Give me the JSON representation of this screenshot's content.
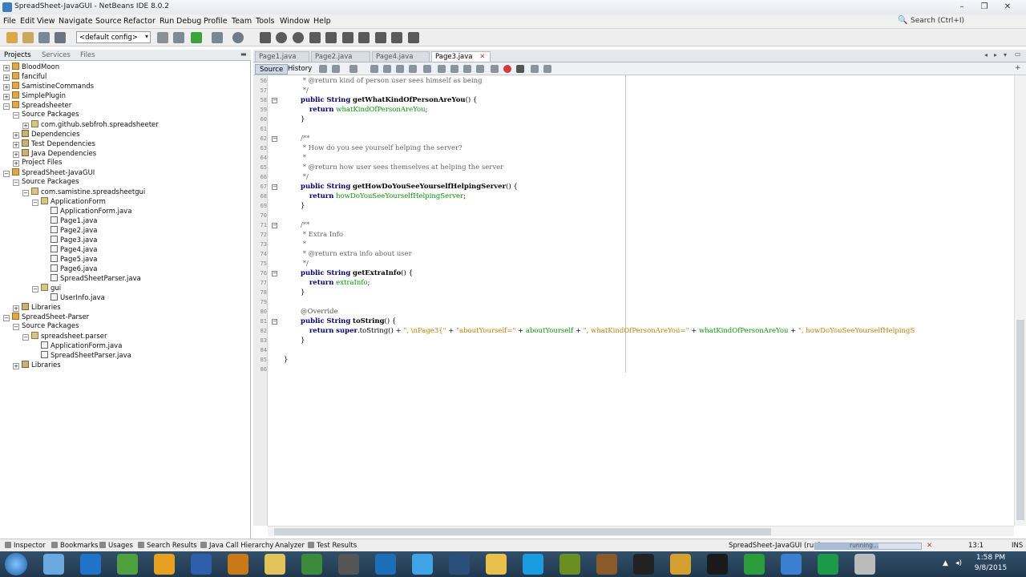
{
  "window": {
    "title": "SpreadSheet-JavaGUI - NetBeans IDE 8.0.2",
    "controls": [
      "–",
      "❐",
      "✕"
    ]
  },
  "menubar": {
    "items": [
      "File",
      "Edit",
      "View",
      "Navigate",
      "Source",
      "Refactor",
      "Run",
      "Debug",
      "Profile",
      "Team",
      "Tools",
      "Window",
      "Help"
    ],
    "search_placeholder": "Search (Ctrl+I)"
  },
  "toolbar": {
    "config_value": "<default config>"
  },
  "left_panel": {
    "tabs": [
      "Projects",
      "Services",
      "Files"
    ],
    "tree": [
      {
        "label": "BloodMoon",
        "depth": 0,
        "icon": "proj",
        "exp": "+"
      },
      {
        "label": "fanciful",
        "depth": 0,
        "icon": "proj",
        "exp": "+"
      },
      {
        "label": "SamistineCommands",
        "depth": 0,
        "icon": "proj",
        "exp": "+"
      },
      {
        "label": "SimplePlugin",
        "depth": 0,
        "icon": "proj",
        "exp": "+"
      },
      {
        "label": "Spreadsheeter",
        "depth": 0,
        "icon": "proj",
        "exp": "−"
      },
      {
        "label": "Source Packages",
        "depth": 1,
        "icon": "fold",
        "exp": "−"
      },
      {
        "label": "com.github.sebfroh.spreadsheeter",
        "depth": 2,
        "icon": "pkg",
        "exp": "+"
      },
      {
        "label": "Dependencies",
        "depth": 1,
        "icon": "lib",
        "exp": "+"
      },
      {
        "label": "Test Dependencies",
        "depth": 1,
        "icon": "lib",
        "exp": "+"
      },
      {
        "label": "Java Dependencies",
        "depth": 1,
        "icon": "lib",
        "exp": "+"
      },
      {
        "label": "Project Files",
        "depth": 1,
        "icon": "fold",
        "exp": "+"
      },
      {
        "label": "SpreadSheet-JavaGUI",
        "depth": 0,
        "icon": "proj",
        "exp": "−"
      },
      {
        "label": "Source Packages",
        "depth": 1,
        "icon": "fold",
        "exp": "−"
      },
      {
        "label": "com.samistine.spreadsheetgui",
        "depth": 2,
        "icon": "pkg",
        "exp": "−"
      },
      {
        "label": "ApplicationForm",
        "depth": 3,
        "icon": "pkg",
        "exp": "−"
      },
      {
        "label": "ApplicationForm.java",
        "depth": 4,
        "icon": "file",
        "exp": ""
      },
      {
        "label": "Page1.java",
        "depth": 4,
        "icon": "file",
        "exp": ""
      },
      {
        "label": "Page2.java",
        "depth": 4,
        "icon": "file",
        "exp": ""
      },
      {
        "label": "Page3.java",
        "depth": 4,
        "icon": "file",
        "exp": ""
      },
      {
        "label": "Page4.java",
        "depth": 4,
        "icon": "file",
        "exp": ""
      },
      {
        "label": "Page5.java",
        "depth": 4,
        "icon": "file",
        "exp": ""
      },
      {
        "label": "Page6.java",
        "depth": 4,
        "icon": "file",
        "exp": ""
      },
      {
        "label": "SpreadSheetParser.java",
        "depth": 4,
        "icon": "file",
        "exp": ""
      },
      {
        "label": "gui",
        "depth": 3,
        "icon": "pkg",
        "exp": "−"
      },
      {
        "label": "UserInfo.java",
        "depth": 4,
        "icon": "file",
        "exp": ""
      },
      {
        "label": "Libraries",
        "depth": 1,
        "icon": "lib",
        "exp": "+"
      },
      {
        "label": "SpreadSheet-Parser",
        "depth": 0,
        "icon": "proj",
        "exp": "−"
      },
      {
        "label": "Source Packages",
        "depth": 1,
        "icon": "fold",
        "exp": "−"
      },
      {
        "label": "spreadsheet.parser",
        "depth": 2,
        "icon": "pkg",
        "exp": "−"
      },
      {
        "label": "ApplicationForm.java",
        "depth": 3,
        "icon": "file",
        "exp": ""
      },
      {
        "label": "SpreadSheetParser.java",
        "depth": 3,
        "icon": "file",
        "exp": ""
      },
      {
        "label": "Libraries",
        "depth": 1,
        "icon": "lib",
        "exp": "+"
      }
    ]
  },
  "editor": {
    "tabs": [
      {
        "label": "Page1.java",
        "active": false
      },
      {
        "label": "Page2.java",
        "active": false
      },
      {
        "label": "Page4.java",
        "active": false
      },
      {
        "label": "Page3.java",
        "active": true
      }
    ],
    "source_label": "Source",
    "history_label": "History",
    "lines": [
      {
        "n": "56",
        "html": "<span class='cmt'> * @return kind of person user sees himself as being</span>"
      },
      {
        "n": "57",
        "html": "<span class='cmt'> */</span>"
      },
      {
        "n": "58",
        "html": "<span class='kw'>public</span> <span class='kw'>String</span> <b>getWhatKindOfPersonAreYou</b>() {",
        "fold": true
      },
      {
        "n": "59",
        "html": "    <span class='kw'>return</span> <span class='fld'>whatKindOfPersonAreYou</span>;"
      },
      {
        "n": "60",
        "html": "}"
      },
      {
        "n": "61",
        "html": ""
      },
      {
        "n": "62",
        "html": "<span class='cmt'>/**</span>",
        "fold": true
      },
      {
        "n": "63",
        "html": "<span class='cmt'> * How do you see yourself helping the server?</span>"
      },
      {
        "n": "64",
        "html": "<span class='cmt'> *</span>"
      },
      {
        "n": "65",
        "html": "<span class='cmt'> * @return how user sees themselves at helping the server</span>"
      },
      {
        "n": "66",
        "html": "<span class='cmt'> */</span>"
      },
      {
        "n": "67",
        "html": "<span class='kw'>public</span> <span class='kw'>String</span> <b>getHowDoYouSeeYourselfHelpingServer</b>() {",
        "fold": true
      },
      {
        "n": "68",
        "html": "    <span class='kw'>return</span> <span class='fld'>howDoYouSeeYourselfHelpingServer</span>;"
      },
      {
        "n": "69",
        "html": "}"
      },
      {
        "n": "70",
        "html": ""
      },
      {
        "n": "71",
        "html": "<span class='cmt'>/**</span>",
        "fold": true
      },
      {
        "n": "72",
        "html": "<span class='cmt'> * Extra Info</span>"
      },
      {
        "n": "73",
        "html": "<span class='cmt'> *</span>"
      },
      {
        "n": "74",
        "html": "<span class='cmt'> * @return extra info about user</span>"
      },
      {
        "n": "75",
        "html": "<span class='cmt'> */</span>"
      },
      {
        "n": "76",
        "html": "<span class='kw'>public</span> <span class='kw'>String</span> <b>getExtraInfo</b>() {",
        "fold": true
      },
      {
        "n": "77",
        "html": "    <span class='kw'>return</span> <span class='fld'>extraInfo</span>;"
      },
      {
        "n": "78",
        "html": "}"
      },
      {
        "n": "79",
        "html": ""
      },
      {
        "n": "80",
        "html": "<span class='ann'>@Override</span>"
      },
      {
        "n": "81",
        "html": "<span class='kw'>public</span> <span class='kw'>String</span> <b>toString</b>() {",
        "fold": true
      },
      {
        "n": "82",
        "html": "    <span class='kw'>return</span> <span class='kw'>super</span>.toString() + <span class='str'>\", \\nPage3{\"</span> + <span class='str'>\"aboutYourself=\"</span> + <span class='fld'>aboutYourself</span> + <span class='str'>\", whatKindOfPersonAreYou=\"</span> + <span class='fld'>whatKindOfPersonAreYou</span> + <span class='str'>\", howDoYouSeeYourselfHelpingS</span>"
      },
      {
        "n": "83",
        "html": "}"
      },
      {
        "n": "84",
        "html": ""
      },
      {
        "n": "85",
        "html": "}",
        "outer": true
      },
      {
        "n": "86",
        "html": ""
      }
    ]
  },
  "bottom": {
    "items": [
      "Inspector",
      "Bookmarks",
      "Usages",
      "Search Results",
      "Java Call Hierarchy",
      "Analyzer",
      "Test Results"
    ],
    "run_status": "SpreadSheet-JavaGUI (run)",
    "progress_label": "running...",
    "progress_fraction": 0.6,
    "caret_pos": "13:1",
    "ins_mode": "INS"
  },
  "taskbar": {
    "time": "1:58 PM",
    "date": "9/8/2015",
    "icon_colors": [
      "#6aa9e0",
      "#1f73c8",
      "#4fa03e",
      "#e8a020",
      "#2d5faa",
      "#c97a17",
      "#e2c25a",
      "#3c8b3a",
      "#555555",
      "#1a6fb8",
      "#3fa5e6",
      "#2a4f7a",
      "#e8c04a",
      "#1a9de0",
      "#6b8e23",
      "#8b5a2b",
      "#222222",
      "#d4a030",
      "#1a1a1a",
      "#2a9d3a",
      "#3a7fd0",
      "#1c9a4a",
      "#bbbbbb"
    ]
  }
}
